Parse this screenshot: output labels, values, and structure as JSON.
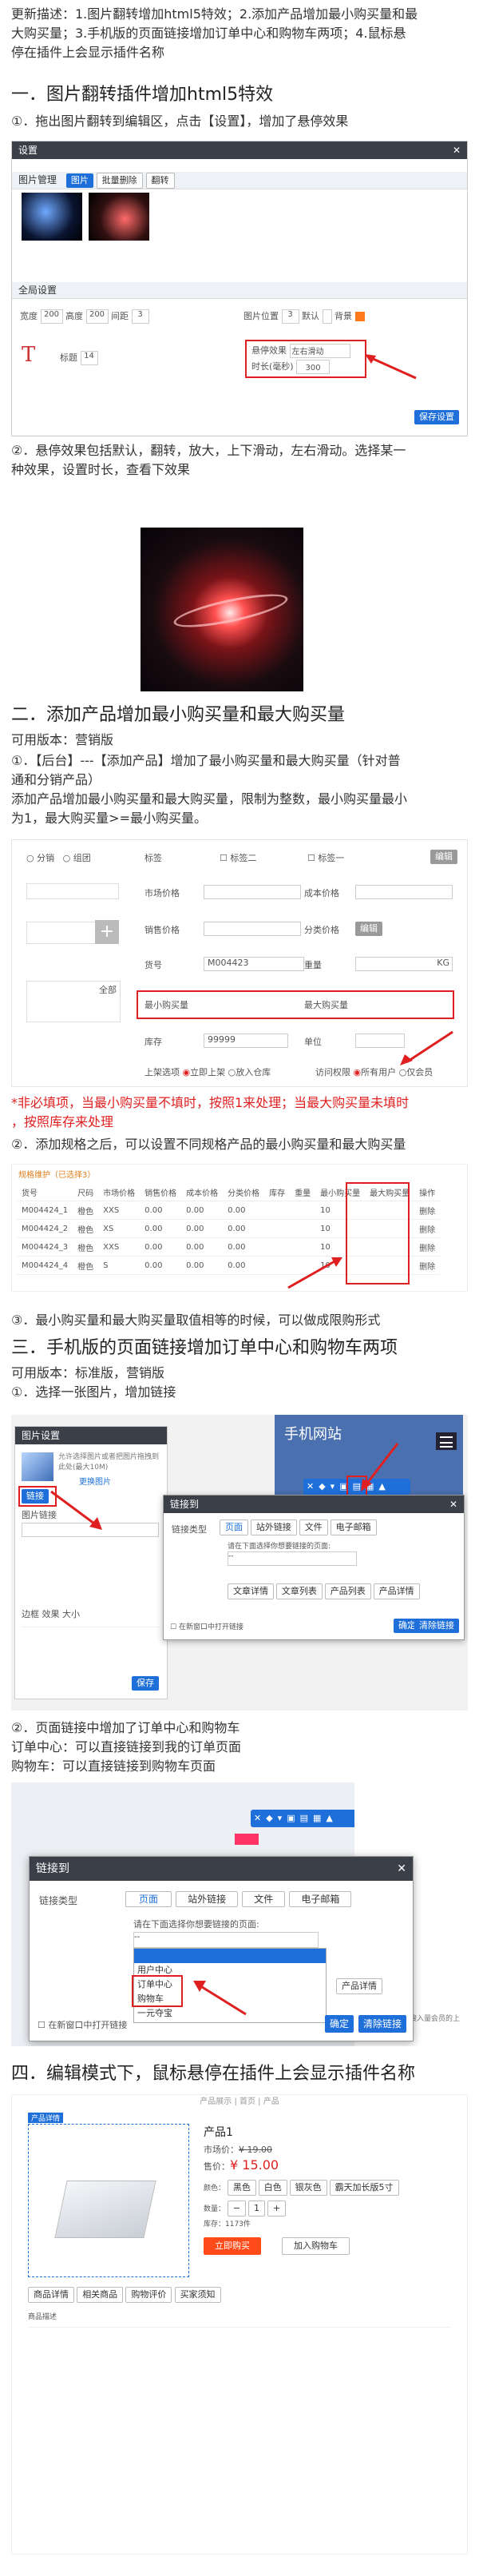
{
  "intro": {
    "line1": "更新描述：1.图片翻转增加html5特效；2.添加产品增加最小购买量和最",
    "line2": "大购买量；3.手机版的页面链接增加订单中心和购物车两项；4.鼠标悬",
    "line3": "停在插件上会显示插件名称"
  },
  "s1": {
    "title": "一．图片翻转插件增加html5特效",
    "step1": "①．拖出图片翻转到编辑区，点击【设置】，增加了悬停效果",
    "dialog": {
      "title": "设置",
      "tab_label": "图片管理",
      "tab_chip1": "图片",
      "tab_chip2": "批量删除",
      "tab_chip3": "翻转",
      "global": "全局设置",
      "w_label": "宽度",
      "w_val": "200",
      "h_label": "高度",
      "h_val": "200",
      "r_label": "间距",
      "r_val": "3",
      "pos_label": "图片位置",
      "pos_val": "3",
      "dflt_label": "默认",
      "bg_label": "背景",
      "title_label": "标题",
      "size_val": "14",
      "hover_label": "悬停效果",
      "hover_val": "左右滑动",
      "dur_label": "时长(毫秒)",
      "dur_val": "300",
      "save": "保存设置"
    },
    "step2a": "②．悬停效果包括默认，翻转，放大，上下滑动，左右滑动。选择某一",
    "step2b": "种效果，设置时长，查看下效果"
  },
  "s2": {
    "title": "二．添加产品增加最小购买量和最大购买量",
    "ver": "可用版本：营销版",
    "d1a": "①．【后台】---【添加产品】增加了最小购买量和最大购买量（针对普",
    "d1b": "通和分销产品）",
    "d2a": "添加产品增加最小购买量和最大购买量，限制为整数，最小购买量最小",
    "d2b": "为1，最大购买量>=最小购买量。",
    "form": {
      "r1a": "分销",
      "r1b": "组团",
      "tag_label": "标签",
      "tag1": "标签二",
      "tag2": "标签一",
      "tag_btn": "编辑",
      "market": "市场价格",
      "cost": "成本价格",
      "sale": "销售价格",
      "cat": "分类价格",
      "cat_btn": "编辑",
      "sku": "货号",
      "sku_val": "M004423",
      "weight": "重量",
      "weight_unit": "KG",
      "min": "最小购买量",
      "max": "最大购买量",
      "stock": "库存",
      "stock_val": "99999",
      "unit": "单位",
      "onsale": "上架选项",
      "on1": "立即上架",
      "on2": "放入仓库",
      "access": "访问权限",
      "ac1": "所有用户",
      "ac2": "仅会员",
      "sel": "全部"
    },
    "note1": "*非必填项，当最小购买量不填时，按照1来处理；当最大购买量未填时",
    "note2": "，按照库存来处理",
    "step2": "②．添加规格之后，可以设置不同规格产品的最小购买量和最大购买量",
    "spec": {
      "caption": "规格维护（已选择3）",
      "headers": [
        "货号",
        "尺码",
        "市场价格",
        "销售价格",
        "成本价格",
        "分类价格",
        "库存",
        "重量",
        "最小购买量",
        "最大购买量",
        "操作"
      ],
      "rows": [
        [
          "M004424_1",
          "橙色",
          "XXS",
          "0.00",
          "0.00",
          "0.00",
          "",
          "",
          "10",
          "",
          "删除"
        ],
        [
          "M004424_2",
          "橙色",
          "XS",
          "0.00",
          "0.00",
          "0.00",
          "",
          "",
          "10",
          "",
          "删除"
        ],
        [
          "M004424_3",
          "橙色",
          "XXS",
          "0.00",
          "0.00",
          "0.00",
          "",
          "",
          "10",
          "",
          "删除"
        ],
        [
          "M004424_4",
          "橙色",
          "S",
          "0.00",
          "0.00",
          "0.00",
          "",
          "",
          "10",
          "",
          "删除"
        ]
      ]
    },
    "step3": "③．最小购买量和最大购买量取值相等的时候，可以做成限购形式"
  },
  "s3": {
    "title": "三．手机版的页面链接增加订单中心和购物车两项",
    "ver": "可用版本：标准版，营销版",
    "step1": "①．选择一张图片，增加链接",
    "img_dialog": {
      "title": "图片设置",
      "desc": "允许选择图片或者把图片拖拽到此处(最大10M)",
      "change": "更换图片",
      "link_label": "图片链接",
      "link_btn": "链接",
      "t1": "边框",
      "t2": "效果",
      "t3": "大小",
      "save": "保存"
    },
    "phone": {
      "title": "手机网站",
      "edit_tag": "编辑"
    },
    "link_small": {
      "title": "链接到",
      "type": "链接类型",
      "tab1": "页面",
      "tab2": "站外链接",
      "tab3": "文件",
      "tab4": "电子邮箱",
      "prompt": "请在下面选择你想要链接的页面:",
      "opt": "--",
      "b1": "文章详情",
      "b2": "文章列表",
      "b3": "产品列表",
      "b4": "产品详情",
      "ok": "确定",
      "clear": "清除链接",
      "newwin": "在新窗口中打开链接"
    },
    "step2": "②．页面链接中增加了订单中心和购物车",
    "order": "订单中心：可以直接链接到我的订单页面",
    "cart": "购物车：可以直接链接到购物车页面",
    "link_big": {
      "title": "链接到",
      "type": "链接类型",
      "tab1": "页面",
      "tab2": "站外链接",
      "tab3": "文件",
      "tab4": "电子邮箱",
      "prompt": "请在下面选择你想要链接的页面:",
      "opt_sel": "--",
      "item1": "用户中心",
      "item2": "订单中心",
      "item3": "购物车",
      "item4": "一元夺宝",
      "prod": "产品详情",
      "ok": "确定",
      "clear": "清除链接",
      "newwin": "在新窗口中打开链接",
      "side": "下降，在某些热搜入量会员的上方，(站"
    }
  },
  "s4": {
    "title": "四．编辑模式下，鼠标悬停在插件上会显示插件名称",
    "product": {
      "tag": "产品详情",
      "top": "产品展示 | 首页 | 产品",
      "name": "产品1",
      "market_label": "市场价：",
      "market_val": "¥ 19.00",
      "price_label": "售价：",
      "price_val": "¥ 15.00",
      "spec_label": "颜色：",
      "sizes": [
        "黑色",
        "白色",
        "银灰色",
        "霸天加长版5寸"
      ],
      "qty_label": "数量：",
      "qty_val": "1",
      "stock": "库存：1173件",
      "buy": "立即购买",
      "cart": "加入购物车",
      "tabs": [
        "商品详情",
        "相关商品",
        "购物评价",
        "买家须知"
      ],
      "desc": "商品描述"
    }
  },
  "colors": {
    "accent": "#1e6fd9",
    "alert": "#e02020",
    "orange": "#ff7a1a"
  }
}
